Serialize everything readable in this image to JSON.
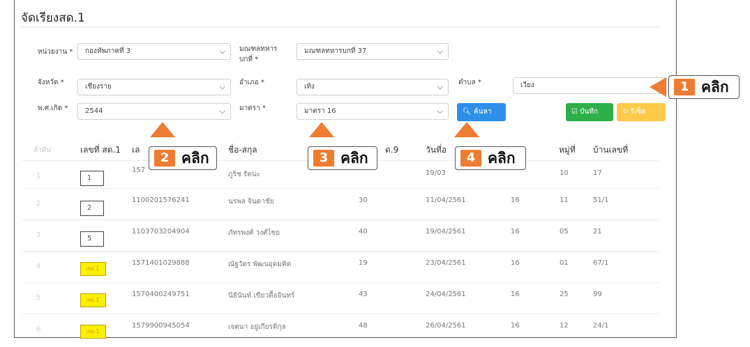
{
  "page": {
    "title": "จัดเรียงสด.1"
  },
  "filters": {
    "unit": {
      "label": "หน่วยงาน *",
      "value": "กองทัพภาคที่ 3"
    },
    "military_circle": {
      "label_line1": "มณฑลทหาร",
      "label_line2": "บกที่ *",
      "value": "มณฑลทหารบกที่ 37"
    },
    "province": {
      "label": "จังหวัด *",
      "value": "เชียงราย"
    },
    "district": {
      "label": "อำเภอ *",
      "value": "เทิง"
    },
    "subdistrict": {
      "label": "ตำบล *",
      "value": "เวียง"
    },
    "birth_year": {
      "label": "พ.ศ.เกิด *",
      "value": "2544"
    },
    "section": {
      "label": "มาตรา *",
      "value": "มาตรา 16"
    }
  },
  "buttons": {
    "search": "ค้นหา",
    "save": "บันทึก",
    "reset": "รีเซ็ต"
  },
  "table": {
    "headers": {
      "order": "ลำดับ",
      "sd1_no": "เลขที่ สด.1",
      "id_partial": "เล",
      "name": "ชื่อ-สกุล",
      "sd9_partial": "ด.9",
      "date_partial": "วันที่อ",
      "moo": "หมู่ที่",
      "house_no": "บ้านเลขที่"
    },
    "rows": [
      {
        "order": "1",
        "sd1": "1",
        "id": "157",
        "name": "ภูริช รัตนะ",
        "sd9": "",
        "date": "19/03",
        "sec": "",
        "moo": "10",
        "house": "17"
      },
      {
        "order": "2",
        "sd1": "2",
        "id": "1100201576241",
        "name": "นรพล จินดาชัย",
        "sd9": "30",
        "date": "11/04/2561",
        "sec": "16",
        "moo": "11",
        "house": "51/1"
      },
      {
        "order": "3",
        "sd1": "5",
        "id": "1103703204904",
        "name": "ภัทรพงศ์ วงศ์ไชย",
        "sd9": "40",
        "date": "19/04/2561",
        "sec": "16",
        "moo": "05",
        "house": "21"
      },
      {
        "order": "4",
        "sd1": "สด.1",
        "id": "1571401029888",
        "name": "ณัฐวัตร พัฒนอุดมคิด",
        "sd9": "19",
        "date": "23/04/2561",
        "sec": "16",
        "moo": "01",
        "house": "67/1"
      },
      {
        "order": "5",
        "sd1": "สด.1",
        "id": "1570400249751",
        "name": "นิธินันท์ เขียวตื้ออินทร์",
        "sd9": "43",
        "date": "24/04/2561",
        "sec": "16",
        "moo": "25",
        "house": "99"
      },
      {
        "order": "6",
        "sd1": "สด.1",
        "id": "1579900945054",
        "name": "เจตนา อยู่เกียรติกุล",
        "sd9": "48",
        "date": "26/04/2561",
        "sec": "16",
        "moo": "12",
        "house": "24/1"
      }
    ]
  },
  "callouts": [
    {
      "num": "1",
      "word": "คลิก"
    },
    {
      "num": "2",
      "word": "คลิก"
    },
    {
      "num": "3",
      "word": "คลิก"
    },
    {
      "num": "4",
      "word": "คลิก"
    }
  ],
  "colors": {
    "accent": "#ee7c32",
    "primary": "#2f8ee8",
    "success": "#2eaf4a",
    "warning": "#ffc94a",
    "highlight": "#ffef00"
  },
  "icons": {
    "select": "chevron-down-icon",
    "search": "search-icon",
    "save": "check-square-icon",
    "reset": "refresh-icon"
  }
}
